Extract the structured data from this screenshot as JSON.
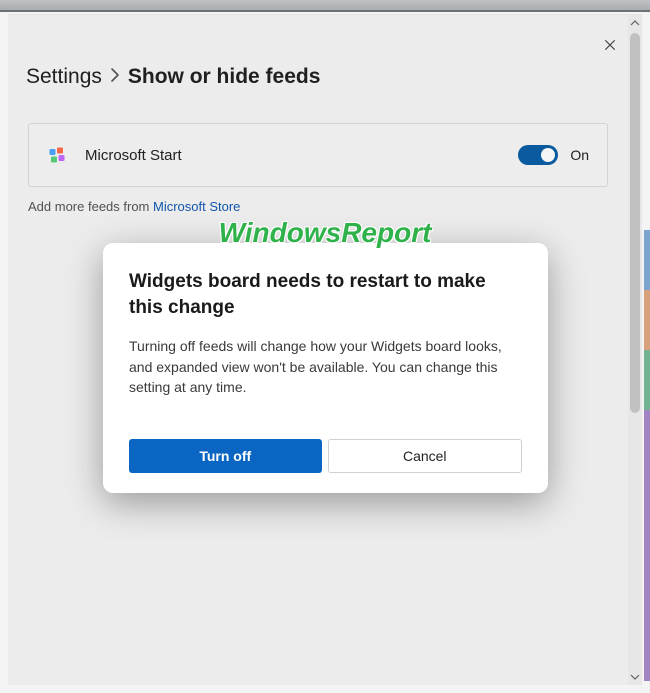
{
  "breadcrumb": {
    "root": "Settings",
    "leaf": "Show or hide feeds"
  },
  "feed": {
    "name": "Microsoft Start",
    "toggle_state_label": "On"
  },
  "add_feeds": {
    "prefix": "Add more feeds from ",
    "link": "Microsoft Store"
  },
  "watermark": "WindowsReport",
  "dialog": {
    "title": "Widgets board needs to restart to make this change",
    "body": "Turning off feeds will change how your Widgets board looks, and expanded view won't be available. You can change this setting at any time.",
    "primary": "Turn off",
    "secondary": "Cancel"
  }
}
